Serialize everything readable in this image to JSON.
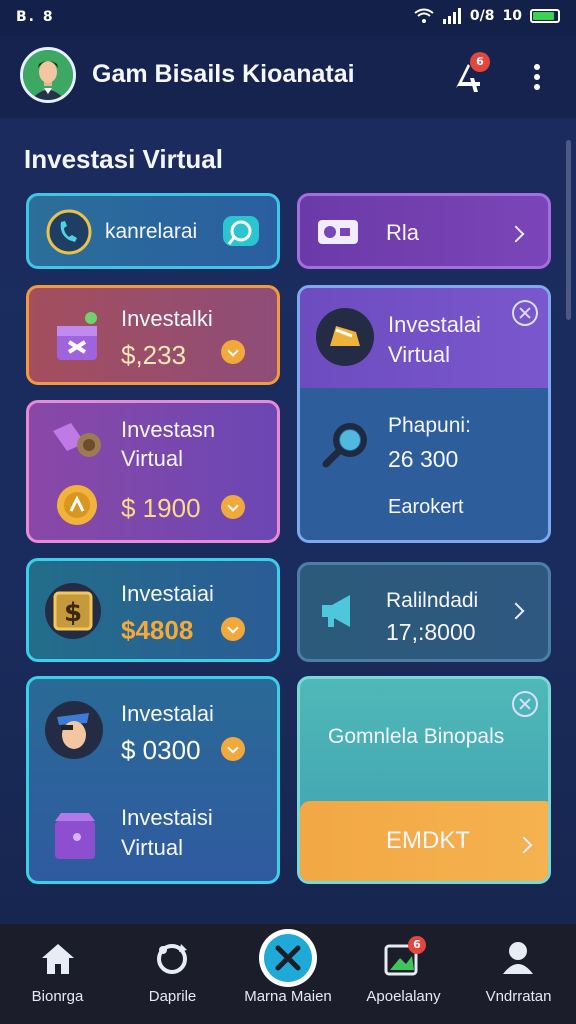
{
  "status_bar": {
    "left_text": "B. 8",
    "signal_text": "0/8",
    "battery_prefix": "10",
    "battery_level": 0.8
  },
  "header": {
    "title": "Gam Bisails Kioanatai",
    "notification_badge": "6"
  },
  "section_title": "Investasi Virtual",
  "cards": {
    "c1": {
      "label": "kanrelarai",
      "icon": "phone-icon"
    },
    "c2": {
      "label": "Rla",
      "icon": "ticket-icon"
    },
    "c3": {
      "label": "Investalki",
      "amount": "$,233",
      "icon": "gift-box-icon"
    },
    "c4": {
      "label_line1": "Investalai",
      "label_line2": "Virtual",
      "icon": "chest-icon"
    },
    "c5": {
      "label_line1": "Phapuni:",
      "amount": "26 300",
      "sub": "Earokert",
      "icon": "magnifier-icon"
    },
    "c6": {
      "label_line1": "Investasn",
      "label_line2": "Virtual",
      "amount": "$ 1900",
      "icon": "coin-icon"
    },
    "c7": {
      "label": "Investaiai",
      "amount": "$4808",
      "icon": "dollar-tile-icon"
    },
    "c8": {
      "label_line1": "Ralilndadi",
      "amount": "17,:8000",
      "icon": "megaphone-icon"
    },
    "c9": {
      "label": "Investalai",
      "amount": "$ 0300",
      "label2_line1": "Investaisi",
      "label2_line2": "Virtual",
      "icon": "pirate-avatar-icon"
    },
    "c10": {
      "label": "Gomnlela Binopals",
      "button_label": "EMDKT"
    }
  },
  "bottom_nav": [
    {
      "label": "Bionrga",
      "icon": "home-icon"
    },
    {
      "label": "Daprile",
      "icon": "refresh-icon"
    },
    {
      "label": "Marna Maien",
      "icon": "close-center-icon"
    },
    {
      "label": "Apoelalany",
      "icon": "photo-icon",
      "badge": "6"
    },
    {
      "label": "Vndrratan",
      "icon": "user-icon"
    }
  ],
  "colors": {
    "accent_orange": "#f2a93b",
    "cyan_border": "#3ad0e8",
    "purple": "#8a4fd0"
  }
}
